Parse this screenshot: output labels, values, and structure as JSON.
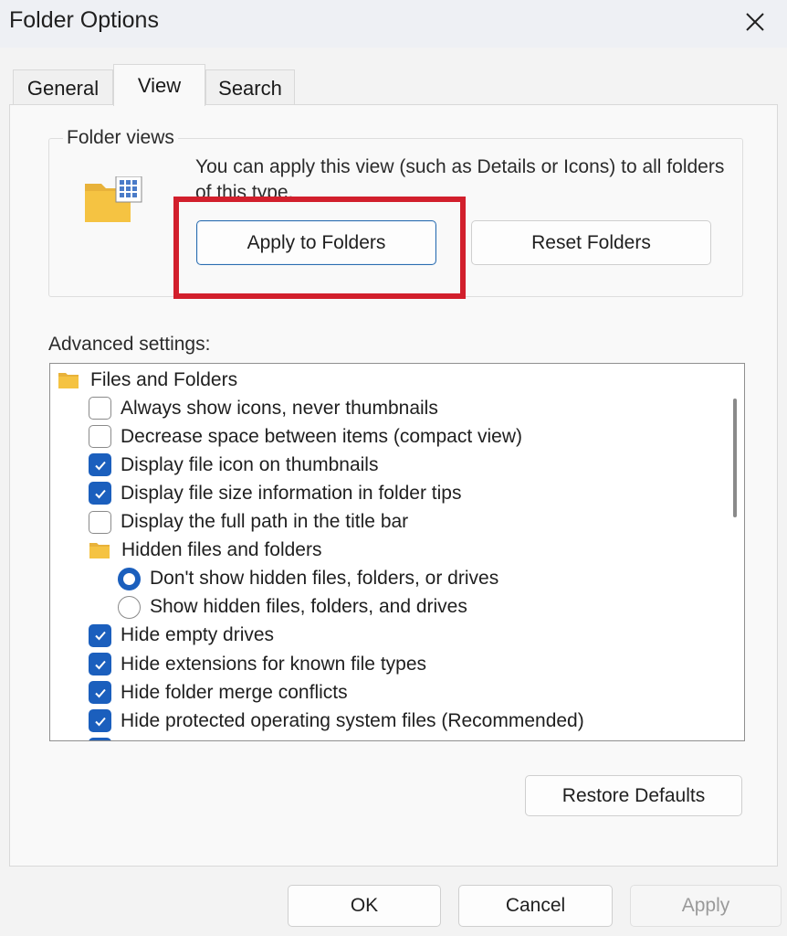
{
  "window": {
    "title": "Folder Options",
    "close_icon": "close-icon"
  },
  "tabs": [
    {
      "label": "General",
      "active": false
    },
    {
      "label": "View",
      "active": true
    },
    {
      "label": "Search",
      "active": false
    }
  ],
  "folder_views": {
    "label": "Folder views",
    "description": "You can apply this view (such as Details or Icons) to all folders of this type.",
    "apply_button": "Apply to Folders",
    "reset_button": "Reset Folders",
    "icon": "folder-view-icon"
  },
  "advanced": {
    "label": "Advanced settings:",
    "items": [
      {
        "type": "folder",
        "label": "Files and Folders",
        "level": 0
      },
      {
        "type": "checkbox",
        "label": "Always show icons, never thumbnails",
        "checked": false,
        "level": 1
      },
      {
        "type": "checkbox",
        "label": "Decrease space between items (compact view)",
        "checked": false,
        "level": 1
      },
      {
        "type": "checkbox",
        "label": "Display file icon on thumbnails",
        "checked": true,
        "level": 1
      },
      {
        "type": "checkbox",
        "label": "Display file size information in folder tips",
        "checked": true,
        "level": 1
      },
      {
        "type": "checkbox",
        "label": "Display the full path in the title bar",
        "checked": false,
        "level": 1
      },
      {
        "type": "folder",
        "label": "Hidden files and folders",
        "level": 1
      },
      {
        "type": "radio",
        "label": "Don't show hidden files, folders, or drives",
        "checked": true,
        "level": 2
      },
      {
        "type": "radio",
        "label": "Show hidden files, folders, and drives",
        "checked": false,
        "level": 2
      },
      {
        "type": "checkbox",
        "label": "Hide empty drives",
        "checked": true,
        "level": 1
      },
      {
        "type": "checkbox",
        "label": "Hide extensions for known file types",
        "checked": true,
        "level": 1
      },
      {
        "type": "checkbox",
        "label": "Hide folder merge conflicts",
        "checked": true,
        "level": 1
      },
      {
        "type": "checkbox",
        "label": "Hide protected operating system files (Recommended)",
        "checked": true,
        "level": 1
      },
      {
        "type": "checkbox",
        "label": "",
        "checked": true,
        "level": 1
      }
    ]
  },
  "restore_button": "Restore Defaults",
  "footer": {
    "ok": "OK",
    "cancel": "Cancel",
    "apply": "Apply",
    "apply_enabled": false
  },
  "colors": {
    "accent": "#1b5fbd",
    "highlight": "#d21f2c",
    "folder": "#f5c342"
  }
}
